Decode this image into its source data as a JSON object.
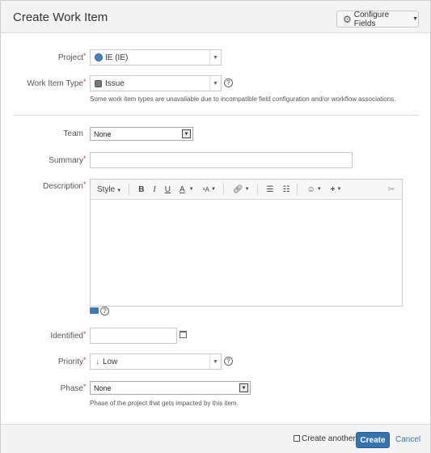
{
  "dialog": {
    "title": "Create Work Item",
    "configure_label": "Configure Fields",
    "icons": {
      "gear": "gear-icon",
      "caret": "chevron-down-icon"
    }
  },
  "fields": {
    "project": {
      "label": "Project",
      "value": "IE (IE)"
    },
    "work_item_type": {
      "label": "Work Item Type",
      "value": "Issue",
      "hint": "Some work item types are unavailable due to incompatible field configuration and/or workflow associations."
    },
    "team": {
      "label": "Team",
      "value": "None"
    },
    "summary": {
      "label": "Summary",
      "value": ""
    },
    "description": {
      "label": "Description",
      "toolbar": {
        "style": "Style",
        "bold": "B",
        "italic": "I",
        "underline": "U",
        "color": "A",
        "text_size": "ᵃA"
      }
    },
    "identified": {
      "label": "Identified",
      "value": ""
    },
    "priority": {
      "label": "Priority",
      "value": "Low",
      "icon": "↓"
    },
    "phase": {
      "label": "Phase",
      "value": "None",
      "hint": "Phase of the project that gets impacted by this item."
    }
  },
  "footer": {
    "create_another_label": "Create another",
    "create_label": "Create",
    "cancel_label": "Cancel"
  },
  "colors": {
    "accent": "#3572b0",
    "required": "#d04437",
    "link": "#3b73af"
  }
}
